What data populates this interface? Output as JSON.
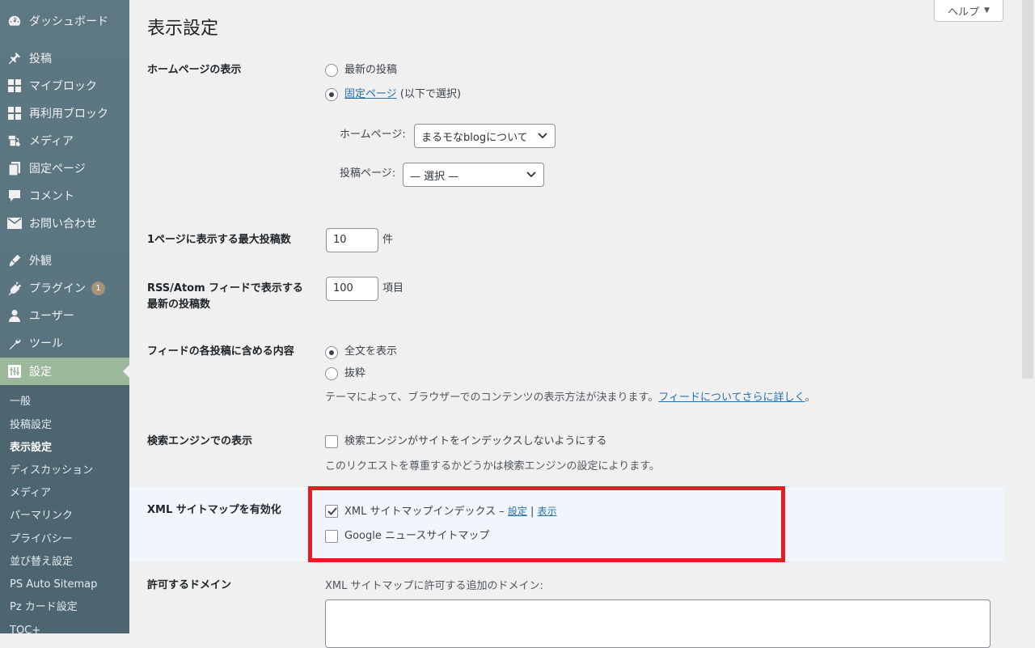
{
  "sidebar": {
    "items": [
      {
        "label": "ダッシュボード",
        "icon": "dashboard-icon"
      },
      {
        "label": "投稿",
        "icon": "pin-icon"
      },
      {
        "label": "マイブロック",
        "icon": "block-grid-icon"
      },
      {
        "label": "再利用ブロック",
        "icon": "block-grid-icon"
      },
      {
        "label": "メディア",
        "icon": "media-icon"
      },
      {
        "label": "固定ページ",
        "icon": "page-icon"
      },
      {
        "label": "コメント",
        "icon": "comment-icon"
      },
      {
        "label": "お問い合わせ",
        "icon": "mail-icon"
      },
      {
        "label": "外観",
        "icon": "brush-icon"
      },
      {
        "label": "プラグイン",
        "icon": "plugin-icon",
        "badge": "1"
      },
      {
        "label": "ユーザー",
        "icon": "user-icon"
      },
      {
        "label": "ツール",
        "icon": "wrench-icon"
      },
      {
        "label": "設定",
        "icon": "settings-icon",
        "active": true
      }
    ],
    "submenu": [
      {
        "label": "一般"
      },
      {
        "label": "投稿設定"
      },
      {
        "label": "表示設定",
        "current": true
      },
      {
        "label": "ディスカッション"
      },
      {
        "label": "メディア"
      },
      {
        "label": "パーマリンク"
      },
      {
        "label": "プライバシー"
      },
      {
        "label": "並び替え設定"
      },
      {
        "label": "PS Auto Sitemap"
      },
      {
        "label": "Pz カード設定"
      },
      {
        "label": "TOC+"
      }
    ]
  },
  "header": {
    "title": "表示設定",
    "help_label": "ヘルプ",
    "help_caret": "▼"
  },
  "homepage": {
    "label": "ホームページの表示",
    "option_latest": "最新の投稿",
    "option_static_link": "固定ページ",
    "option_static_suffix": " (以下で選択)",
    "homepage_select_label": "ホームページ:",
    "homepage_select_value": "まるモなblogについて",
    "posts_select_label": "投稿ページ:",
    "posts_select_value": "— 選択 —"
  },
  "posts_per_page": {
    "label": "1ページに表示する最大投稿数",
    "value": "10",
    "unit": "件"
  },
  "rss": {
    "label_line1": "RSS/Atom フィードで表示する",
    "label_line2": "最新の投稿数",
    "value": "100",
    "unit": "項目"
  },
  "feed_content": {
    "label": "フィードの各投稿に含める内容",
    "option_full": "全文を表示",
    "option_excerpt": "抜粋",
    "desc_prefix": "テーマによって、ブラウザーでのコンテンツの表示方法が決まります。",
    "desc_link": "フィードについてさらに詳しく",
    "desc_suffix": "。"
  },
  "search_engine": {
    "label": "検索エンジンでの表示",
    "checkbox_label": "検索エンジンがサイトをインデックスしないようにする",
    "desc": "このリクエストを尊重するかどうかは検索エンジンの設定によります。"
  },
  "xml_sitemap": {
    "label": "XML サイトマップを有効化",
    "index_label": "XML サイトマップインデックス –",
    "link_settings": "設定",
    "separator": "|",
    "link_view": "表示",
    "news_label": "Google ニュースサイトマップ"
  },
  "domains": {
    "label": "許可するドメイン",
    "desc": "XML サイトマップに許可する追加のドメイン:"
  },
  "colors": {
    "accent": "#2271b1",
    "highlight_border": "#e41d25",
    "sidebar_bg": "#5a7580",
    "active_menu_bg": "#9bb89b"
  }
}
